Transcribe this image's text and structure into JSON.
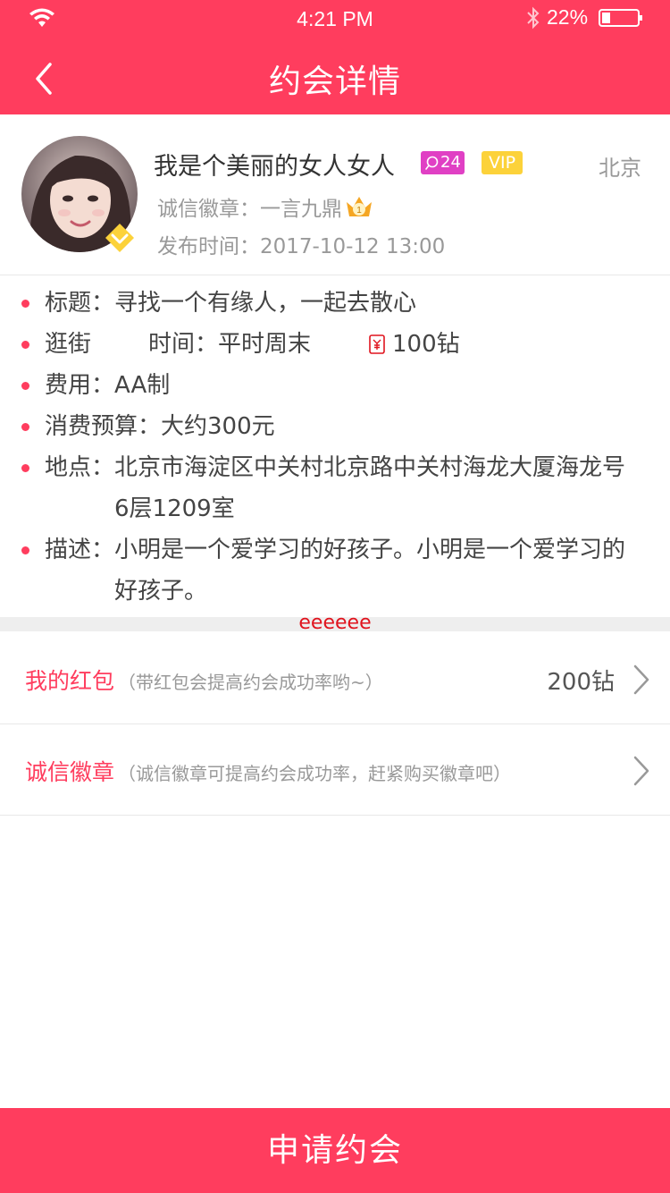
{
  "status_bar": {
    "time": "4:21 PM",
    "battery": "22%"
  },
  "nav": {
    "title": "约会详情"
  },
  "profile": {
    "nickname": "我是个美丽的女人女人",
    "message_count": "24",
    "vip": "VIP",
    "city": "北京",
    "credit_label": "诚信徽章：一言九鼎",
    "crown_level": "1",
    "publish_time": "发布时间：2017-10-12 13:00"
  },
  "details": {
    "title": "标题：寻找一个有缘人，一起去散心",
    "activity": "逛街",
    "time": "时间：平时周末",
    "reward": "100钻",
    "fee": "费用：AA制",
    "budget": "消费预算：大约300元",
    "location_line1": "地点：北京市海淀区中关村北京路中关村海龙大厦海龙号",
    "location_line2": "6层1209室",
    "description_line1": "描述：小明是一个爱学习的好孩子。小明是一个爱学习的",
    "description_line2": "好孩子。"
  },
  "divider_label": "eeeeee",
  "red_packet": {
    "label": "我的红包",
    "hint": "（带红包会提高约会成功率哟~）",
    "value": "200钻"
  },
  "credit_badge": {
    "label": "诚信徽章",
    "hint": "（诚信徽章可提高约会成功率，赶紧购买徽章吧）"
  },
  "apply_button": "申请约会",
  "colors": {
    "accent": "#ff3d5e",
    "vip": "#fcd23a",
    "message_badge": "#e040c4"
  }
}
